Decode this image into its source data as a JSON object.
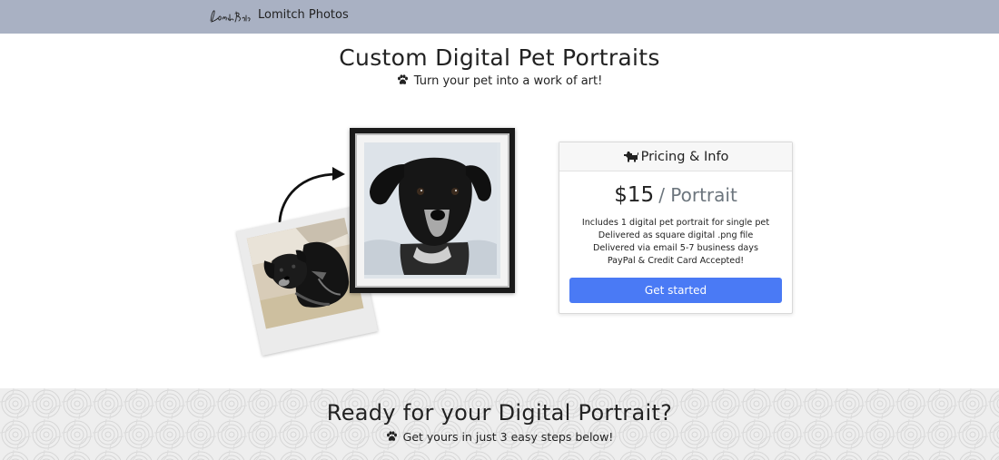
{
  "navbar": {
    "brand_logo_text": "Lomitch Photos",
    "brand_name": "Lomitch Photos"
  },
  "hero": {
    "title": "Custom Digital Pet Portraits",
    "subtitle": "Turn your pet into a work of art!",
    "subtitle_icon": "paw-icon"
  },
  "pricing": {
    "header": "Pricing & Info",
    "header_icon": "dog-icon",
    "price": "$15",
    "unit": "/ Portrait",
    "features": [
      "Includes 1 digital pet portrait for single pet",
      "Delivered as square digital .png file",
      "Delivered via email 5-7 business days",
      "PayPal & Credit Card Accepted!"
    ],
    "cta_label": "Get started"
  },
  "steps": {
    "title": "Ready for your Digital Portrait?",
    "subtitle": "Get yours in just 3 easy steps below!",
    "subtitle_icon": "paw-icon"
  },
  "colors": {
    "navbar_bg": "#a9b1c3",
    "button_bg": "#4a7af5",
    "price_unit": "#6c757d"
  }
}
